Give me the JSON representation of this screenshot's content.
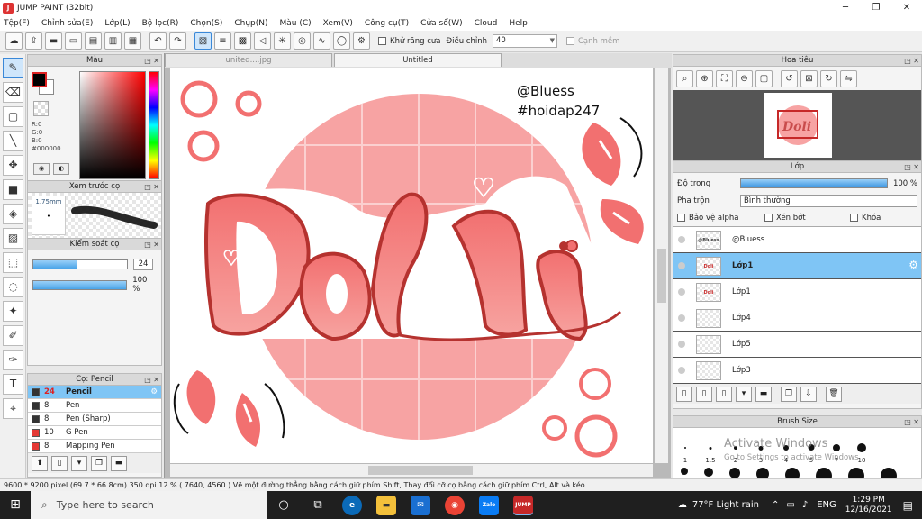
{
  "window": {
    "title": "JUMP PAINT (32bit)",
    "app_icon": "J",
    "minimize": "─",
    "maximize": "❐",
    "close": "✕"
  },
  "menu": [
    "Tệp(F)",
    "Chỉnh sửa(E)",
    "Lớp(L)",
    "Bộ lọc(R)",
    "Chọn(S)",
    "Chụp(N)",
    "Màu (C)",
    "Xem(V)",
    "Công cụ(T)",
    "Cửa sổ(W)",
    "Cloud",
    "Help"
  ],
  "toolbar": {
    "antialias_label": "Khử răng cưa",
    "adjust_label": "Điều chỉnh",
    "adjust_value": "40",
    "edge_label": "Cạnh mềm"
  },
  "panels": {
    "color": {
      "title": "Màu",
      "r": "R:0",
      "g": "G:0",
      "b": "B:0",
      "hex": "#000000"
    },
    "preview": {
      "title": "Xem trước cọ",
      "size": "1.75mm"
    },
    "control": {
      "title": "Kiểm soát cọ",
      "size_value": "24",
      "size_fill": 0.46,
      "opacity_value": "100 %",
      "opacity_fill": 1.0
    },
    "brush": {
      "title": "Cọ: Pencil",
      "items": [
        {
          "size": "24",
          "name": "Pencil",
          "color": "#333333",
          "selected": true
        },
        {
          "size": "8",
          "name": "Pen",
          "color": "#333333",
          "selected": false
        },
        {
          "size": "8",
          "name": "Pen (Sharp)",
          "color": "#333333",
          "selected": false
        },
        {
          "size": "10",
          "name": "G Pen",
          "color": "#e53935",
          "selected": false
        },
        {
          "size": "8",
          "name": "Mapping Pen",
          "color": "#e53935",
          "selected": false
        }
      ]
    },
    "navigator": {
      "title": "Hoa tiêu"
    },
    "layer": {
      "title": "Lớp",
      "opacity_label": "Độ trong",
      "opacity_value": "100 %",
      "blend_label": "Pha trộn",
      "blend_value": "Bình thường",
      "protect_alpha": "Bảo vệ alpha",
      "clip": "Xén bớt",
      "lock": "Khóa",
      "items": [
        {
          "name": "@Bluess",
          "thumb": "@Bluess",
          "selected": false
        },
        {
          "name": "Lớp1",
          "thumb": "Doli",
          "selected": true
        },
        {
          "name": "Lớp1",
          "thumb": "Doli",
          "selected": false
        },
        {
          "name": "Lớp4",
          "thumb": "",
          "selected": false
        },
        {
          "name": "Lớp5",
          "thumb": "",
          "selected": false
        },
        {
          "name": "Lớp3",
          "thumb": "",
          "selected": false
        }
      ]
    },
    "brushsize": {
      "title": "Brush Size",
      "labels": [
        "1",
        "1.5",
        "2",
        "3",
        "4",
        "5",
        "7",
        "10"
      ],
      "watermark_1": "Activate Windows",
      "watermark_2": "Go to Settings to activate Windows."
    }
  },
  "tabs": [
    {
      "label": "united....jpg",
      "active": false
    },
    {
      "label": "Untitled",
      "active": true
    }
  ],
  "artwork": {
    "credit_1": "@Bluess",
    "credit_2": "#hoidap247",
    "word": "Doli",
    "colors": {
      "main": "#f47c7c",
      "dark": "#b5322f",
      "light": "#f9a3a3"
    }
  },
  "status": "9600 * 9200 pixel  (69.7 * 66.8cm)  350 dpi   12 %  ( 7640, 4560 )  Vẽ một đường thẳng bằng cách giữ phím Shift, Thay đổi cỡ cọ bằng cách giữ phím Ctrl, Alt và kéo",
  "taskbar": {
    "search_placeholder": "Type here to search",
    "weather": "77°F  Light rain",
    "lang": "ENG",
    "time": "1:29 PM",
    "date": "12/16/2021",
    "apps": [
      "Zalo",
      "JUMP"
    ]
  }
}
